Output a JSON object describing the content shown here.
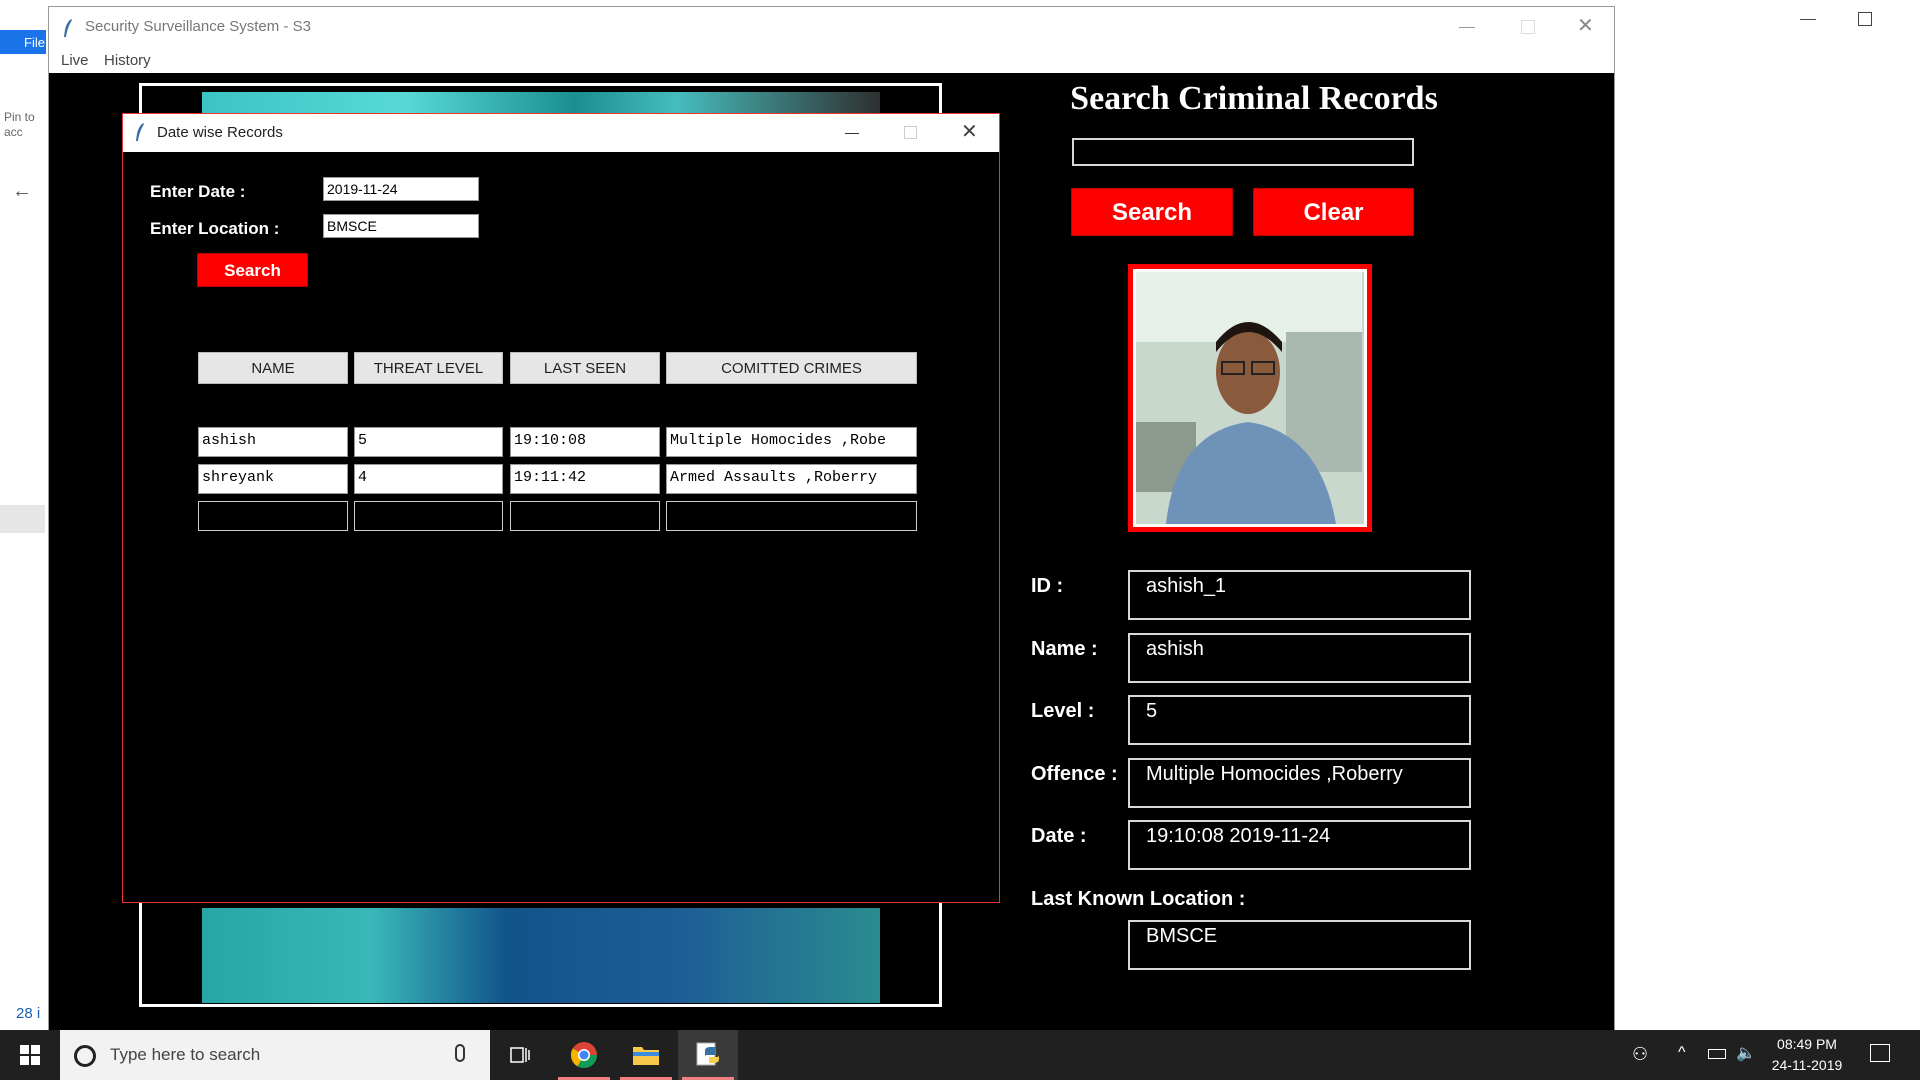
{
  "background": {
    "ribbon_tab": "File",
    "pin_text": "Pin to acc",
    "items_count": "28 i"
  },
  "main_window": {
    "title": "Security Surveillance System - S3",
    "menu": [
      "Live",
      "History"
    ]
  },
  "search_panel": {
    "heading": "Search Criminal Records",
    "search_value": "",
    "search_button": "Search",
    "clear_button": "Clear",
    "fields": {
      "id": {
        "label": "ID :",
        "value": "ashish_1"
      },
      "name": {
        "label": "Name :",
        "value": "ashish"
      },
      "level": {
        "label": "Level :",
        "value": "5"
      },
      "offence": {
        "label": "Offence :",
        "value": "Multiple Homocides ,Roberry"
      },
      "date": {
        "label": "Date :",
        "value": "19:10:08  2019-11-24"
      },
      "location": {
        "label": "Last Known Location :",
        "value": "BMSCE"
      }
    }
  },
  "dialog": {
    "title": "Date wise Records",
    "date_label": "Enter Date :",
    "date_value": "2019-11-24",
    "location_label": "Enter Location :",
    "location_value": "BMSCE",
    "search_button": "Search",
    "columns": [
      "NAME",
      "THREAT LEVEL",
      "LAST SEEN",
      "COMITTED CRIMES"
    ],
    "rows": [
      [
        "ashish",
        "5",
        "19:10:08",
        "Multiple Homocides ,Robe"
      ],
      [
        "shreyank",
        "4",
        "19:11:42",
        "Armed Assaults ,Roberry"
      ]
    ]
  },
  "taskbar": {
    "search_placeholder": "Type here to search",
    "time": "08:49 PM",
    "date": "24-11-2019"
  },
  "colors": {
    "accent_red": "#ff0000",
    "window_bg": "#000000",
    "taskbar_bg": "#202020"
  },
  "icons": [
    "feather-icon",
    "minimize-icon",
    "maximize-icon",
    "close-icon",
    "windows-start-icon",
    "search-icon",
    "microphone-icon",
    "task-view-icon",
    "chrome-icon",
    "file-explorer-icon",
    "python-icon",
    "people-icon",
    "chevron-up-icon",
    "battery-icon",
    "volume-icon",
    "notification-icon"
  ]
}
